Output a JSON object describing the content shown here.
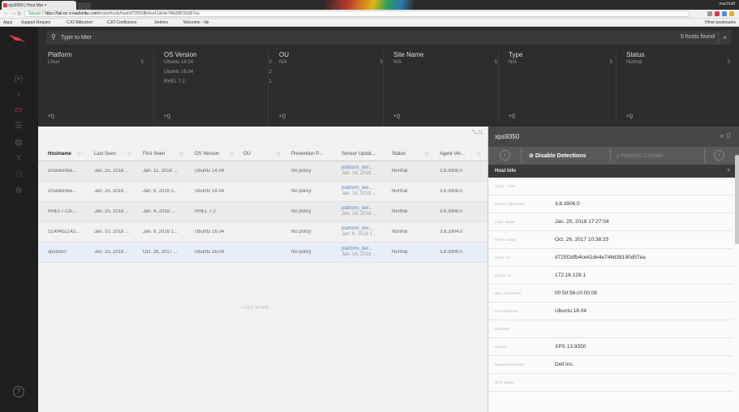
{
  "browser": {
    "tab_title": "xps9350 | Host Mar ×",
    "url_secure": "Secure",
    "url_host": "https://falcon.crowdstrike.com",
    "url_path": "/hosts/hosts/host/d725f2dfb4ce41de4e746d38190d57ea",
    "profile": "mac0raft",
    "bookmarks": [
      "Apps",
      "Support Reques",
      "CJO Bitbucket",
      "CJO Confluence",
      "Jenkins",
      "Welcome - Ne"
    ],
    "other_bookmarks": "Other bookmarks"
  },
  "search": {
    "placeholder": "Type to filter",
    "hosts_found": "5 hosts found",
    "close": "×"
  },
  "filters": [
    {
      "header": "Platform",
      "rows": [
        {
          "label": "Linux",
          "count": "5"
        }
      ],
      "add": "+Q"
    },
    {
      "header": "OS Version",
      "rows": [
        {
          "label": "Ubuntu 14.04",
          "count": "2"
        },
        {
          "label": "Ubuntu 16.04",
          "count": "2"
        },
        {
          "label": "RHEL 7.2",
          "count": "1"
        }
      ],
      "add": "+Q"
    },
    {
      "header": "OU",
      "rows": [
        {
          "label": "N/A",
          "count": "5"
        }
      ],
      "add": "+Q"
    },
    {
      "header": "Site Name",
      "rows": [
        {
          "label": "N/A",
          "count": "5"
        }
      ],
      "add": "+Q"
    },
    {
      "header": "Type",
      "rows": [
        {
          "label": "N/A",
          "count": "5"
        }
      ],
      "add": "+Q"
    },
    {
      "header": "Status",
      "rows": [
        {
          "label": "Normal",
          "count": "5"
        }
      ],
      "add": "+Q"
    }
  ],
  "table": {
    "columns": [
      "Hostname",
      "Last Seen",
      "First Seen",
      "OS Version",
      "OU",
      "Prevention P...",
      "Sensor Updat...",
      "Status",
      "Agent Ver..."
    ],
    "rows": [
      {
        "hostname": "crowdstrike...",
        "last_seen": "Jan. 25, 2018 ...",
        "first_seen": "Jan. 11, 2018 ...",
        "os": "Ubuntu 14.04",
        "ou": "",
        "prevention": "No policy",
        "sensor1": "platform_def...",
        "sensor2": "Jan. 16, 2018 ...",
        "status": "Normal",
        "agent": "3.8.3906.0"
      },
      {
        "hostname": "crowdstrike...",
        "last_seen": "Jan. 25, 2018 ...",
        "first_seen": "Jan. 9, 2018 2...",
        "os": "Ubuntu 14.04",
        "ou": "",
        "prevention": "No policy",
        "sensor1": "platform_def...",
        "sensor2": "Jan. 16, 2018 ...",
        "status": "Normal",
        "agent": "3.8.3906.0"
      },
      {
        "hostname": "RHEL7-C8-...",
        "last_seen": "Jan. 25, 2018 ...",
        "first_seen": "Jan. 4, 2018 ...",
        "os": "RHEL 7.2",
        "ou": "",
        "prevention": "No policy",
        "sensor1": "platform_def...",
        "sensor2": "Jan. 16, 2018 ...",
        "status": "Normal",
        "agent": "3.8.3906.0"
      },
      {
        "hostname": "S149452142...",
        "last_seen": "Jan. 10, 2018 ...",
        "first_seen": "Jan. 9, 2018 1...",
        "os": "Ubuntu 16.04",
        "ou": "",
        "prevention": "No policy",
        "sensor1": "platform_def...",
        "sensor2": "Jan. 9, 2018 1...",
        "status": "Normal",
        "agent": "3.8.3904.0"
      },
      {
        "hostname": "xps9350",
        "last_seen": "Jan. 25, 2018 ...",
        "first_seen": "Oct. 26, 2017 ...",
        "os": "Ubuntu 16.04",
        "ou": "",
        "prevention": "No policy",
        "sensor1": "platform_def...",
        "sensor2": "Jan. 16, 2018 ...",
        "status": "Normal",
        "agent": "3.8.3906.0"
      }
    ],
    "load_more": "LOAD MORE"
  },
  "side": {
    "title": "xps9350",
    "disable": "Disable Detections",
    "contain": "Network Contain",
    "section": "Host Info",
    "fields": [
      {
        "k": "HOST TYPE",
        "v": ""
      },
      {
        "k": "AGENT VERSION",
        "v": "3.8.3906.0"
      },
      {
        "k": "LAST SEEN",
        "v": "Jan. 25, 2018 17:27:04"
      },
      {
        "k": "FIRST SEEN",
        "v": "Oct. 26, 2017 10:38:25"
      },
      {
        "k": "HOST ID",
        "v": "d725f2dfb4ce41de4e746d38190d57ea"
      },
      {
        "k": "LOCAL IP",
        "v": "172.16.129.1"
      },
      {
        "k": "MAC ADDRESS",
        "v": "00:50:56:c0:00:08"
      },
      {
        "k": "OS VERSION",
        "v": "Ubuntu 16.04"
      },
      {
        "k": "DOMAIN",
        "v": ""
      },
      {
        "k": "MODEL",
        "v": "XPS 13 9350"
      },
      {
        "k": "MANUFACTURER",
        "v": "Dell Inc."
      },
      {
        "k": "SITE NAME",
        "v": ""
      }
    ]
  }
}
